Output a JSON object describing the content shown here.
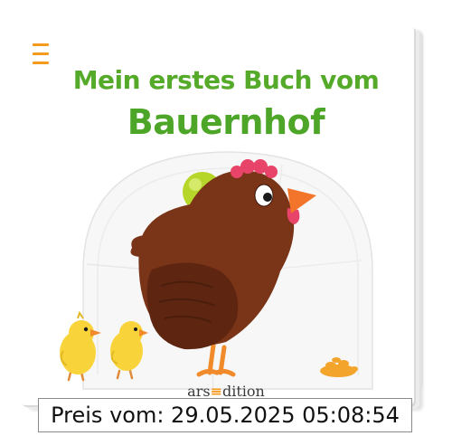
{
  "cover": {
    "title_line1": "Mein erstes Buch vom",
    "title_line2": "Bauernhof",
    "publisher_prefix": "ars",
    "publisher_suffix": "dition",
    "illustration_subject": "brown hen with two yellow chicks"
  },
  "price_label": "Preis vom: 29.05.2025 05:08:54",
  "colors": {
    "title_green": "#55aa2a",
    "accent_orange": "#f39a1f",
    "hen_brown": "#7a3418",
    "chick_yellow": "#f9d33a",
    "ball_green": "#b6d629"
  }
}
